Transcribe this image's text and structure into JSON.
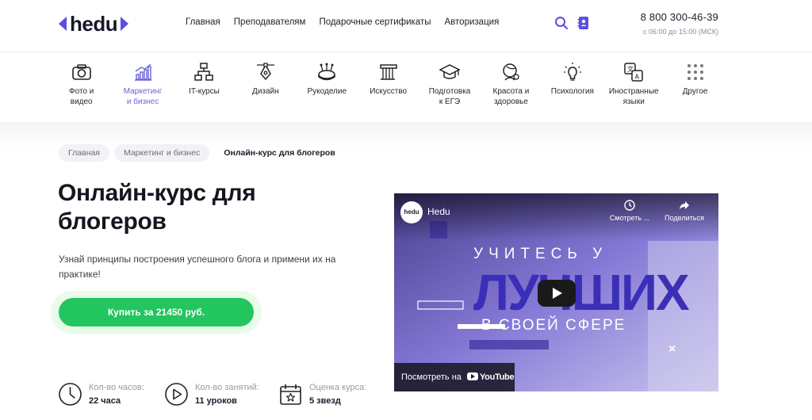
{
  "header": {
    "logo_text": "hedu",
    "nav": [
      "Главная",
      "Преподавателям",
      "Подарочные сертификаты",
      "Авторизация"
    ],
    "phone": "8 800 300-46-39",
    "hours": "с 06:00 до 15:00 (МСК)"
  },
  "categories": [
    {
      "label": "Фото и\nвидео",
      "icon": "camera-icon"
    },
    {
      "label": "Маркетинг\nи бизнес",
      "icon": "chart-icon",
      "active": true
    },
    {
      "label": "IT-курсы",
      "icon": "network-icon"
    },
    {
      "label": "Дизайн",
      "icon": "pen-tool-icon"
    },
    {
      "label": "Рукоделие",
      "icon": "pincushion-icon"
    },
    {
      "label": "Искусство",
      "icon": "column-icon"
    },
    {
      "label": "Подготовка\nк ЕГЭ",
      "icon": "graduation-cap-icon"
    },
    {
      "label": "Красота и\nздоровье",
      "icon": "face-icon"
    },
    {
      "label": "Психология",
      "icon": "lightbulb-icon"
    },
    {
      "label": "Иностранные\nязыки",
      "icon": "translate-icon"
    },
    {
      "label": "Другое",
      "icon": "grid-dots-icon"
    }
  ],
  "breadcrumb": [
    "Главная",
    "Маркетинг и бизнес",
    "Онлайн-курс для блогеров"
  ],
  "hero": {
    "title": "Онлайн-курс для блогеров",
    "subtitle": "Узнай принципы построения успешного блога и примени их на практике!",
    "buy_label": "Купить за 21450 руб."
  },
  "stats": [
    {
      "label": "Кол-во часов:",
      "value": "22 часа",
      "icon": "clock-icon"
    },
    {
      "label": "Кол-во занятий:",
      "value": "11 уроков",
      "icon": "play-circle-icon"
    },
    {
      "label": "Оценка курса:",
      "value": "5 звезд",
      "icon": "calendar-star-icon"
    }
  ],
  "video": {
    "channel_logo": "hedu",
    "channel": "Hedu",
    "watch_later": "Смотреть ...",
    "share": "Поделиться",
    "line1": "УЧИТЕСЬ У",
    "line2": "ЛУЧШИХ",
    "line3": "В СВОЕЙ СФЕРЕ",
    "watch_on": "Посмотреть на",
    "youtube": "YouTube"
  },
  "colors": {
    "accent": "#5b4fe0",
    "buy": "#22c55e",
    "active_category": "#6b63d6"
  }
}
